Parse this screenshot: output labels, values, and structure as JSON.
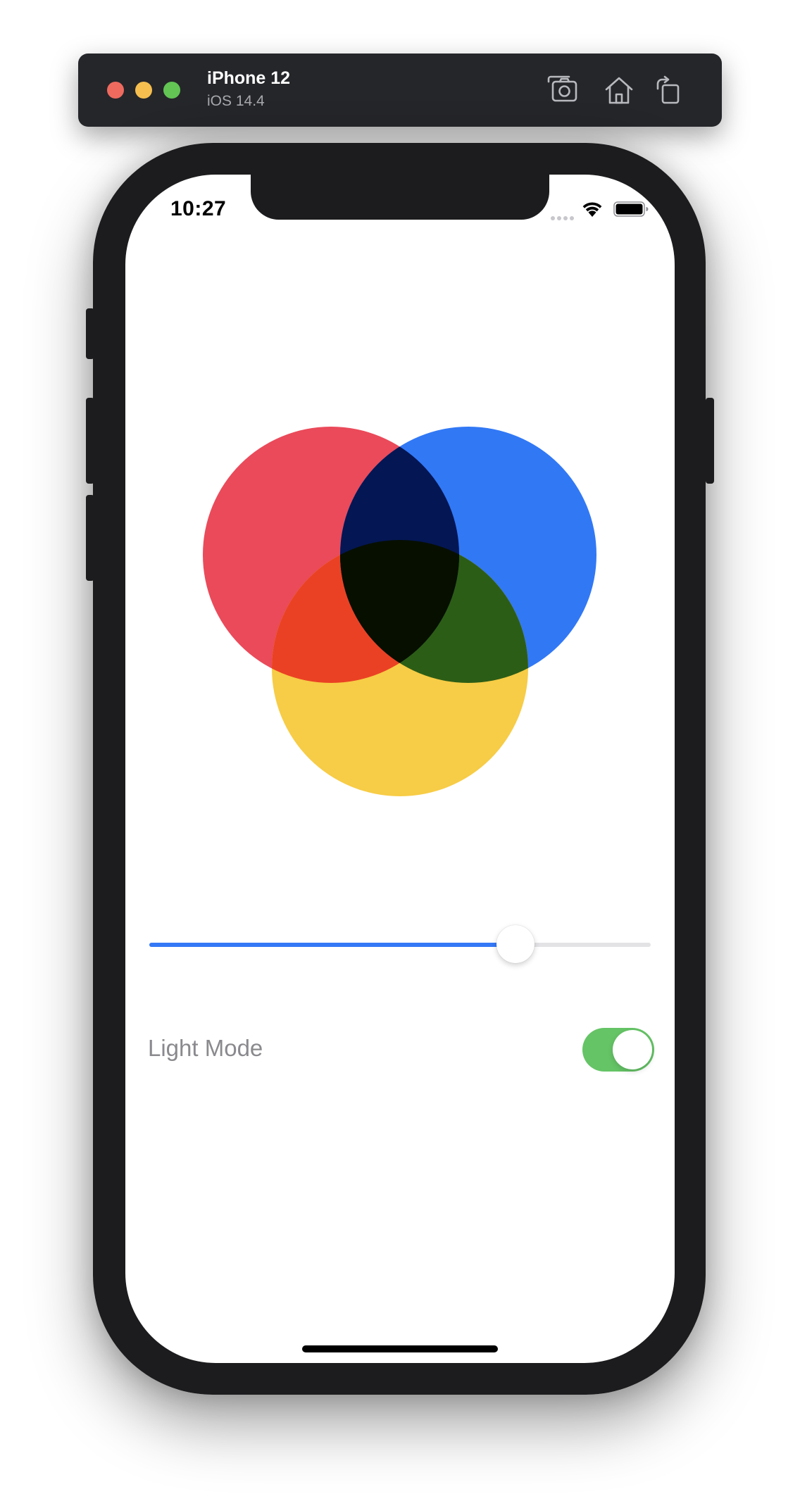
{
  "toolbar": {
    "device_name": "iPhone 12",
    "os_version": "iOS 14.4",
    "icons": [
      "screenshot-icon",
      "home-icon",
      "rotate-icon"
    ],
    "traffic_light_colors": {
      "close": "#ee6a5f",
      "minimize": "#f5be4f",
      "zoom": "#62c554"
    }
  },
  "status_bar": {
    "time": "10:27",
    "icons": [
      "cellular-signal-icon",
      "wifi-icon",
      "battery-icon"
    ]
  },
  "venn": {
    "circles": [
      {
        "name": "red",
        "color": "#ea4a5a"
      },
      {
        "name": "blue",
        "color": "#3178f5"
      },
      {
        "name": "yellow",
        "color": "#f7cc46"
      }
    ],
    "overlap_colors": {
      "red_blue": "#041653",
      "red_yellow": "#ea4124",
      "blue_yellow": "#2c5d16",
      "all": "#070f01"
    }
  },
  "slider": {
    "value": 0.73,
    "fill_color": "#3478f6",
    "track_color": "#e3e3e6"
  },
  "mode_toggle": {
    "label": "Light Mode",
    "on": true,
    "on_color": "#65c466"
  }
}
